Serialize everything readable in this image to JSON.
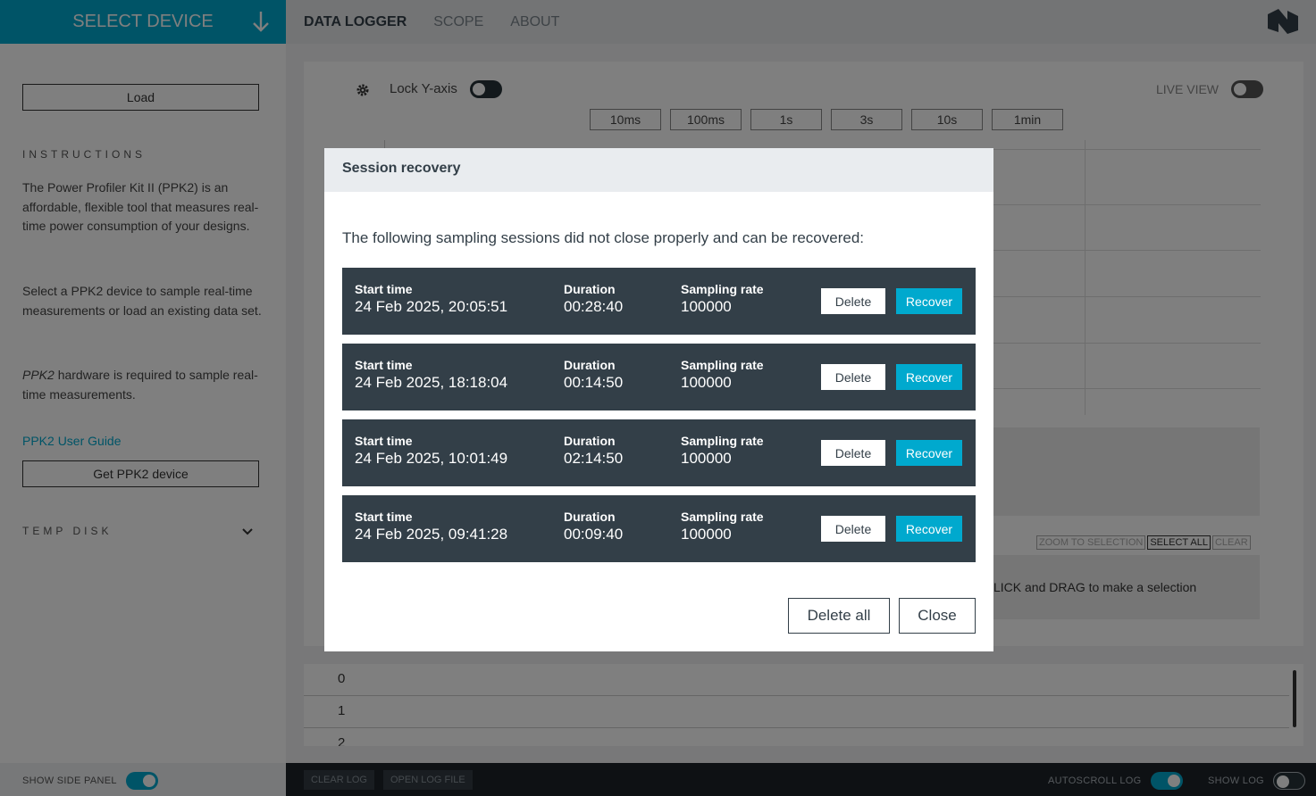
{
  "topbar": {
    "select_device": "SELECT DEVICE",
    "tabs": [
      "DATA LOGGER",
      "SCOPE",
      "ABOUT"
    ]
  },
  "sidepanel": {
    "load_button": "Load",
    "instructions_heading": "INSTRUCTIONS",
    "paragraph1": "The Power Profiler Kit II (PPK2) is an affordable, flexible tool that measures real-time power consumption of your designs.",
    "paragraph2": "Select a PPK2 device to sample real-time measurements or load an existing data set.",
    "paragraph3_em": "PPK2",
    "paragraph3_rest": " hardware is required to sample real-time measurements.",
    "user_guide_link": "PPK2 User Guide",
    "get_device_button": "Get PPK2 device",
    "temp_disk_heading": "TEMP DISK"
  },
  "main": {
    "lock_y_axis_label": "Lock Y-axis",
    "live_view_label": "LIVE VIEW",
    "time_buttons": [
      "10ms",
      "100ms",
      "1s",
      "3s",
      "10s",
      "1min"
    ],
    "selection_buttons": [
      "ZOOM TO SELECTION",
      "SELECT ALL",
      "CLEAR"
    ],
    "drag_hint": "LICK and DRAG to make a selection"
  },
  "log": {
    "rows": [
      "0",
      "1",
      "2"
    ]
  },
  "bottombar": {
    "show_side_panel": "SHOW SIDE PANEL",
    "clear_log": "CLEAR LOG",
    "open_log_file": "OPEN LOG FILE",
    "autoscroll_log": "AUTOSCROLL LOG",
    "show_log": "SHOW LOG",
    "show_side_panel_on": true,
    "autoscroll_on": true,
    "show_log_on": false
  },
  "modal": {
    "title": "Session recovery",
    "intro": "The following sampling sessions did not close properly and can be recovered:",
    "labels": {
      "start_time": "Start time",
      "duration": "Duration",
      "sampling_rate": "Sampling rate",
      "delete": "Delete",
      "recover": "Recover"
    },
    "sessions": [
      {
        "start_time": "24 Feb 2025, 20:05:51",
        "duration": "00:28:40",
        "sampling_rate": "100000"
      },
      {
        "start_time": "24 Feb 2025, 18:18:04",
        "duration": "00:14:50",
        "sampling_rate": "100000"
      },
      {
        "start_time": "24 Feb 2025, 10:01:49",
        "duration": "02:14:50",
        "sampling_rate": "100000"
      },
      {
        "start_time": "24 Feb 2025, 09:41:28",
        "duration": "00:09:40",
        "sampling_rate": "100000"
      }
    ],
    "delete_all": "Delete all",
    "close": "Close"
  },
  "colors": {
    "accent": "#00a9ce",
    "session_bg": "#333f48",
    "header_bg": "#e9ecef"
  }
}
